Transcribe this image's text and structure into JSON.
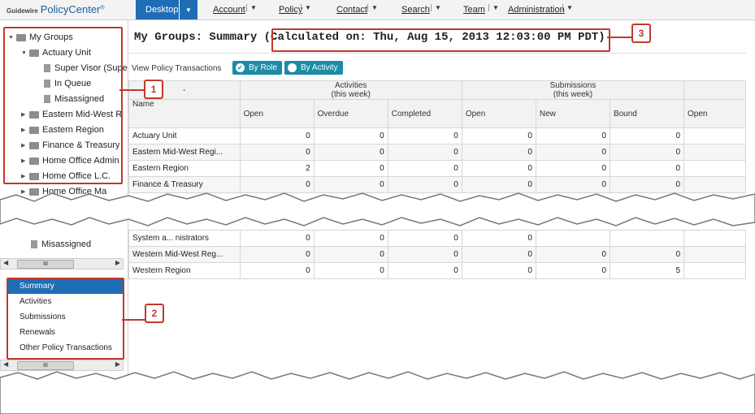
{
  "app": {
    "brand_small": "Guidewire",
    "brand": "PolicyCenter",
    "brand_mark": "®"
  },
  "topmenu": {
    "desktop": "Desktop",
    "items": [
      "Account",
      "Policy",
      "Contact",
      "Search",
      "Team",
      "Administration"
    ]
  },
  "tree": {
    "root": "My Groups",
    "group": "Actuary Unit",
    "leaves": [
      "Super Visor (Supe",
      "In Queue",
      "Misassigned"
    ],
    "siblings": [
      "Eastern Mid-West R",
      "Eastern Region",
      "Finance & Treasury",
      "Home Office Admin",
      "Home Office L.C.",
      "Home Office Ma"
    ],
    "bottom_leaf": "Misassigned"
  },
  "nav": {
    "items": [
      "Summary",
      "Activities",
      "Submissions",
      "Renewals",
      "Other Policy Transactions"
    ],
    "selected": "Summary"
  },
  "main": {
    "title": "My Groups: Summary",
    "calculated": "(Calculated on: Thu, Aug 15, 2013 12:03:00 PM PDT)",
    "view_label": "View Policy Transactions",
    "by_role": "By Role",
    "by_activity": "By Activity"
  },
  "table": {
    "corner": "-",
    "name_header": "Name",
    "group_activities": "Activities",
    "group_activities_sub": "(this week)",
    "group_submissions": "Submissions",
    "group_submissions_sub": "(this week)",
    "columns": [
      "Open",
      "Overdue",
      "Completed",
      "Open",
      "New",
      "Bound",
      "Open"
    ],
    "rows_top": [
      {
        "name": "Actuary Unit",
        "values": [
          "0",
          "0",
          "0",
          "0",
          "0",
          "0"
        ]
      },
      {
        "name": "Eastern Mid-West Regi...",
        "values": [
          "0",
          "0",
          "0",
          "0",
          "0",
          "0"
        ]
      },
      {
        "name": "Eastern Region",
        "values": [
          "2",
          "0",
          "0",
          "0",
          "0",
          "0"
        ]
      },
      {
        "name": "Finance & Treasury",
        "values": [
          "0",
          "0",
          "0",
          "0",
          "0",
          "0"
        ]
      }
    ],
    "rows_bottom": [
      {
        "name": "System a... nistrators",
        "values": [
          "0",
          "0",
          "0",
          "0",
          "",
          ""
        ]
      },
      {
        "name": "Western Mid-West Reg...",
        "values": [
          "0",
          "0",
          "0",
          "0",
          "0",
          "0"
        ]
      },
      {
        "name": "Western Region",
        "values": [
          "0",
          "0",
          "0",
          "0",
          "0",
          "5"
        ]
      }
    ]
  },
  "callouts": [
    "1",
    "2",
    "3"
  ],
  "colors": {
    "accent": "#1f6db5",
    "annotation": "#c0392b",
    "toggle": "#1b8ba6"
  }
}
